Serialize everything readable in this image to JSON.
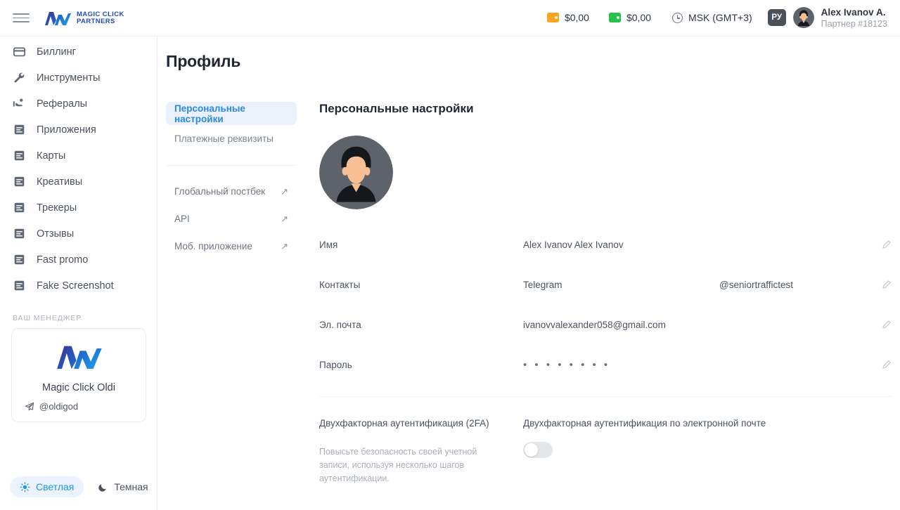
{
  "header": {
    "menu_icon": "hamburger-icon",
    "brand": {
      "line1": "MAGIC CLICK",
      "line2": "PARTNERS"
    },
    "balances": [
      {
        "icon": "wallet-icon-orange",
        "color": "#f5a623",
        "amount": "$0,00"
      },
      {
        "icon": "wallet-icon-green",
        "color": "#27c24c",
        "amount": "$0,00"
      }
    ],
    "timezone": {
      "icon": "clock-icon",
      "label": "MSK (GMT+3)"
    },
    "language": "РУ",
    "user": {
      "name": "Alex Ivanov A.",
      "role": "Партнер #18123",
      "avatar": "user-avatar"
    }
  },
  "sidebar": {
    "items": [
      {
        "label": "Биллинг",
        "icon": "credit-card-icon"
      },
      {
        "label": "Инструменты",
        "icon": "wrench-icon"
      },
      {
        "label": "Рефералы",
        "icon": "referral-hand-icon"
      },
      {
        "label": "Приложения",
        "icon": "document-icon"
      },
      {
        "label": "Карты",
        "icon": "document-icon"
      },
      {
        "label": "Креативы",
        "icon": "document-icon"
      },
      {
        "label": "Трекеры",
        "icon": "document-icon"
      },
      {
        "label": "Отзывы",
        "icon": "document-icon"
      },
      {
        "label": "Fast promo",
        "icon": "document-icon"
      },
      {
        "label": "Fake Screenshot",
        "icon": "document-icon"
      }
    ],
    "manager": {
      "section_label": "ВАШ МЕНЕДЖЕР",
      "name": "Magic Click Oldi",
      "telegram": "@oldigod",
      "telegram_icon": "telegram-icon"
    },
    "theme": {
      "light": {
        "label": "Светлая",
        "icon": "sun-icon",
        "active": true,
        "accent": "#2196f3"
      },
      "dark": {
        "label": "Темная",
        "icon": "moon-icon",
        "active": false
      }
    }
  },
  "main": {
    "page_title": "Профиль",
    "subnav": {
      "tabs": [
        {
          "label": "Персональные настройки",
          "active": true
        },
        {
          "label": "Платежные реквизиты",
          "active": false
        }
      ],
      "links": [
        {
          "label": "Глобальный постбек",
          "icon": "external-link-icon"
        },
        {
          "label": "API",
          "icon": "external-link-icon"
        },
        {
          "label": "Моб. приложение",
          "icon": "external-link-icon"
        }
      ]
    },
    "panel": {
      "title": "Персональные настройки",
      "avatar": "profile-avatar",
      "fields": [
        {
          "label": "Имя",
          "value": "Alex Ivanov Alex Ivanov",
          "value2": "",
          "edit_icon": "pencil-icon"
        },
        {
          "label": "Контакты",
          "value": "Telegram",
          "value2": "@seniortraffictest",
          "edit_icon": "pencil-icon"
        },
        {
          "label": "Эл. почта",
          "value": "ivanovvalexander058@gmail.com",
          "value2": "",
          "edit_icon": "pencil-icon"
        },
        {
          "label": "Пароль",
          "value": "• • • • • • • •",
          "value2": "",
          "edit_icon": "pencil-icon"
        }
      ],
      "two_factor": {
        "title": "Двухфакторная аутентификация (2FA)",
        "description": "Повысьте безопасность своей учетной записи, используя несколько шагов аутентификации.",
        "option_label": "Двухфакторная аутентификация по электронной почте",
        "enabled": false
      }
    }
  }
}
